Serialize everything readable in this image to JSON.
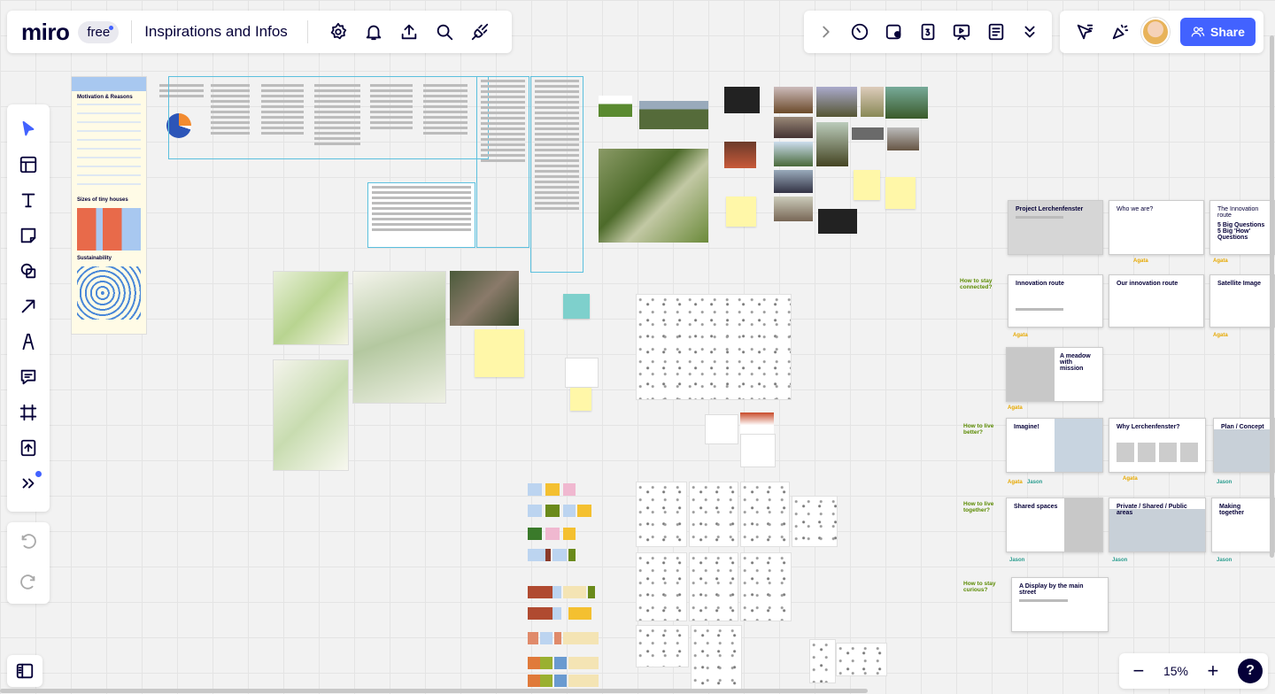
{
  "app": {
    "logo": "miro",
    "plan_badge": "free",
    "board_title": "Inspirations and Infos"
  },
  "topbar_icons": [
    "settings-icon",
    "bell-icon",
    "upload-icon",
    "search-icon",
    "plug-icon"
  ],
  "collab_tools": [
    "chevron-right-icon",
    "timer-icon",
    "voting-icon",
    "card-counter-icon",
    "presentation-icon",
    "notes-icon",
    "double-chevron-down-icon"
  ],
  "share": {
    "label": "Share"
  },
  "zoom": {
    "value": "15%",
    "minus": "−",
    "plus": "+",
    "help": "?"
  },
  "left_tools": [
    "select",
    "templates",
    "text",
    "sticky-note",
    "shapes",
    "arrow",
    "pen",
    "comment",
    "frame",
    "upload",
    "more"
  ],
  "canvas": {
    "poster_sections": [
      "Motivation & Reasons",
      "Sizes of tiny houses",
      "Sustainability"
    ],
    "slides": [
      {
        "title": "Project Lerchenfenster",
        "grey": true
      },
      {
        "title": "Who we are?",
        "grey": false
      },
      {
        "title": "The Innovation route",
        "sub": "5 Big Questions\n5 Big 'How' Questions",
        "grey": false
      },
      {
        "title": "Innovation route",
        "grey": false
      },
      {
        "title": "Our innovation route",
        "grey": false
      },
      {
        "title": "Satellite Image",
        "grey": false
      },
      {
        "title": "A meadow with mission",
        "grey": true
      },
      {
        "title": "Imagine!",
        "grey": true
      },
      {
        "title": "Why Lerchenfenster?",
        "grey": false
      },
      {
        "title": "Plan / Concept",
        "grey": true
      },
      {
        "title": "Shared spaces",
        "grey": true
      },
      {
        "title": "Private / Shared / Public areas",
        "grey": true
      },
      {
        "title": "Making together",
        "grey": false
      },
      {
        "title": "A Display by the main street",
        "grey": false
      }
    ],
    "questions": [
      "How to stay connected?",
      "How to live better?",
      "How to live together?",
      "How to stay curious?"
    ],
    "authors": [
      "Agata",
      "Jason"
    ]
  }
}
